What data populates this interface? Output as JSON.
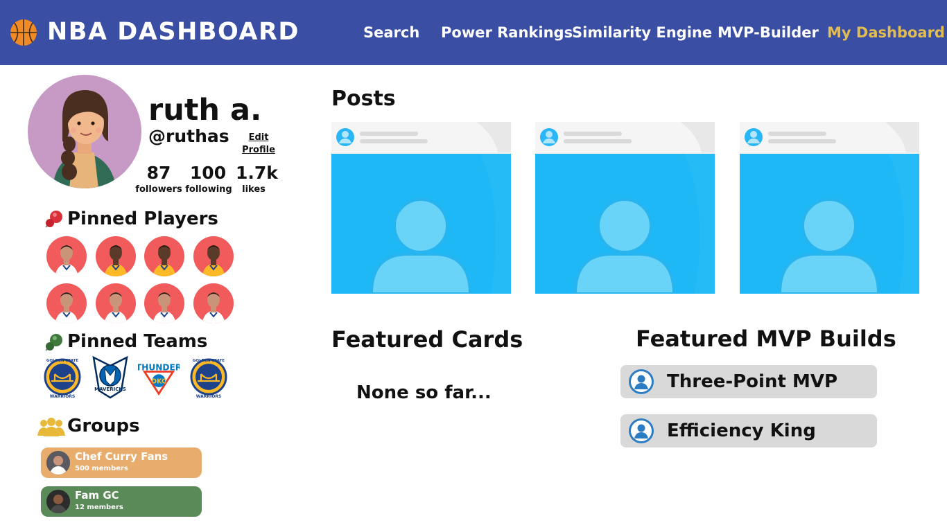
{
  "header": {
    "logo_text": "NBA DASHBOARD",
    "nav": [
      "Search",
      "Power Rankings",
      "Similarity Engine",
      "MVP-Builder",
      "My Dashboard"
    ],
    "active_nav": "My Dashboard",
    "bar_color": "#3a4ea3",
    "active_color": "#e0bc52"
  },
  "profile": {
    "name": "ruth a.",
    "handle": "@ruthas",
    "edit_label": "Edit Profile",
    "stats": {
      "followers_count": "87",
      "followers_label": "followers",
      "following_count": "100",
      "following_label": "following",
      "likes_count": "1.7k",
      "likes_label": "likes"
    }
  },
  "pinned_players": {
    "title": "Pinned Players",
    "icon": "pushpin-icon",
    "players": [
      "player-1",
      "player-2",
      "player-3",
      "player-4",
      "player-5",
      "player-6",
      "player-7",
      "player-8"
    ]
  },
  "pinned_teams": {
    "title": "Pinned Teams",
    "icon": "pushpin-icon",
    "teams": [
      {
        "top": "GOLDEN STATE",
        "bottom": "WARRIORS"
      },
      {
        "top": "",
        "bottom": "MAVERICKS"
      },
      {
        "top": "THUNDER",
        "bottom": "OKC"
      },
      {
        "top": "GOLDEN STATE",
        "bottom": "WARRIORS"
      }
    ]
  },
  "groups": {
    "title": "Groups",
    "icon": "people-icon",
    "items": [
      {
        "name": "Chef Curry Fans",
        "members": "500 members",
        "color": "#e8ad6d"
      },
      {
        "name": "Fam GC",
        "members": "12 members",
        "color": "#5a8a57"
      }
    ]
  },
  "posts": {
    "title": "Posts",
    "count_shown": 3
  },
  "featured_cards": {
    "title": "Featured Cards",
    "empty_text": "None so far..."
  },
  "featured_builds": {
    "title": "Featured MVP Builds",
    "items": [
      "Three-Point MVP",
      "Efficiency King"
    ]
  }
}
